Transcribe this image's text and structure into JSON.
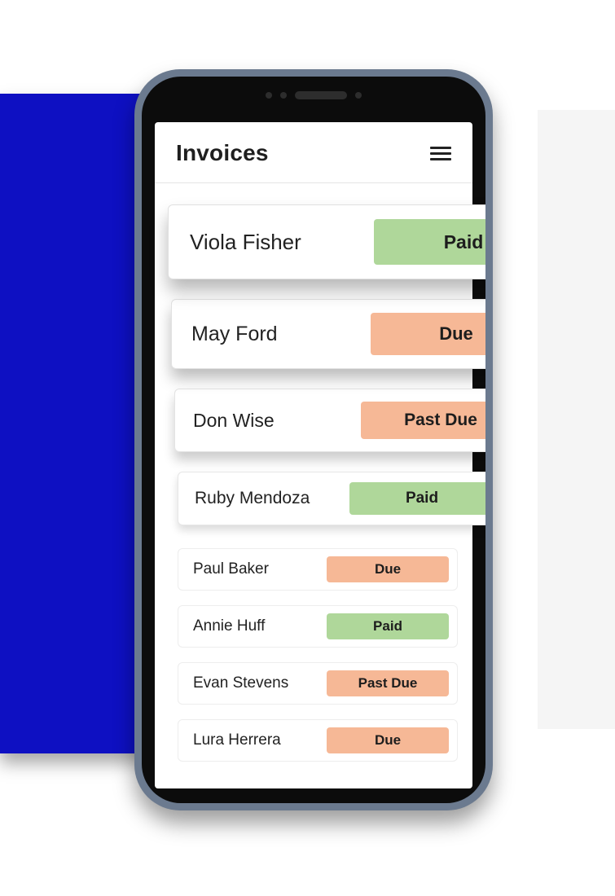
{
  "colors": {
    "accentBlue": "#0e10c2",
    "paid": "#afd79a",
    "due": "#f6b896",
    "pastDue": "#f6b896"
  },
  "header": {
    "title": "Invoices"
  },
  "statusLabels": {
    "paid": "Paid",
    "due": "Due",
    "past-due": "Past Due"
  },
  "invoices": [
    {
      "name": "Viola Fisher",
      "status": "paid",
      "emphasis": 1
    },
    {
      "name": "May Ford",
      "status": "due",
      "emphasis": 2
    },
    {
      "name": "Don Wise",
      "status": "past-due",
      "emphasis": 3
    },
    {
      "name": "Ruby Mendoza",
      "status": "paid",
      "emphasis": 4
    },
    {
      "name": "Paul Baker",
      "status": "due",
      "emphasis": 0
    },
    {
      "name": "Annie Huff",
      "status": "paid",
      "emphasis": 0
    },
    {
      "name": "Evan Stevens",
      "status": "past-due",
      "emphasis": 0
    },
    {
      "name": "Lura Herrera",
      "status": "due",
      "emphasis": 0
    }
  ]
}
